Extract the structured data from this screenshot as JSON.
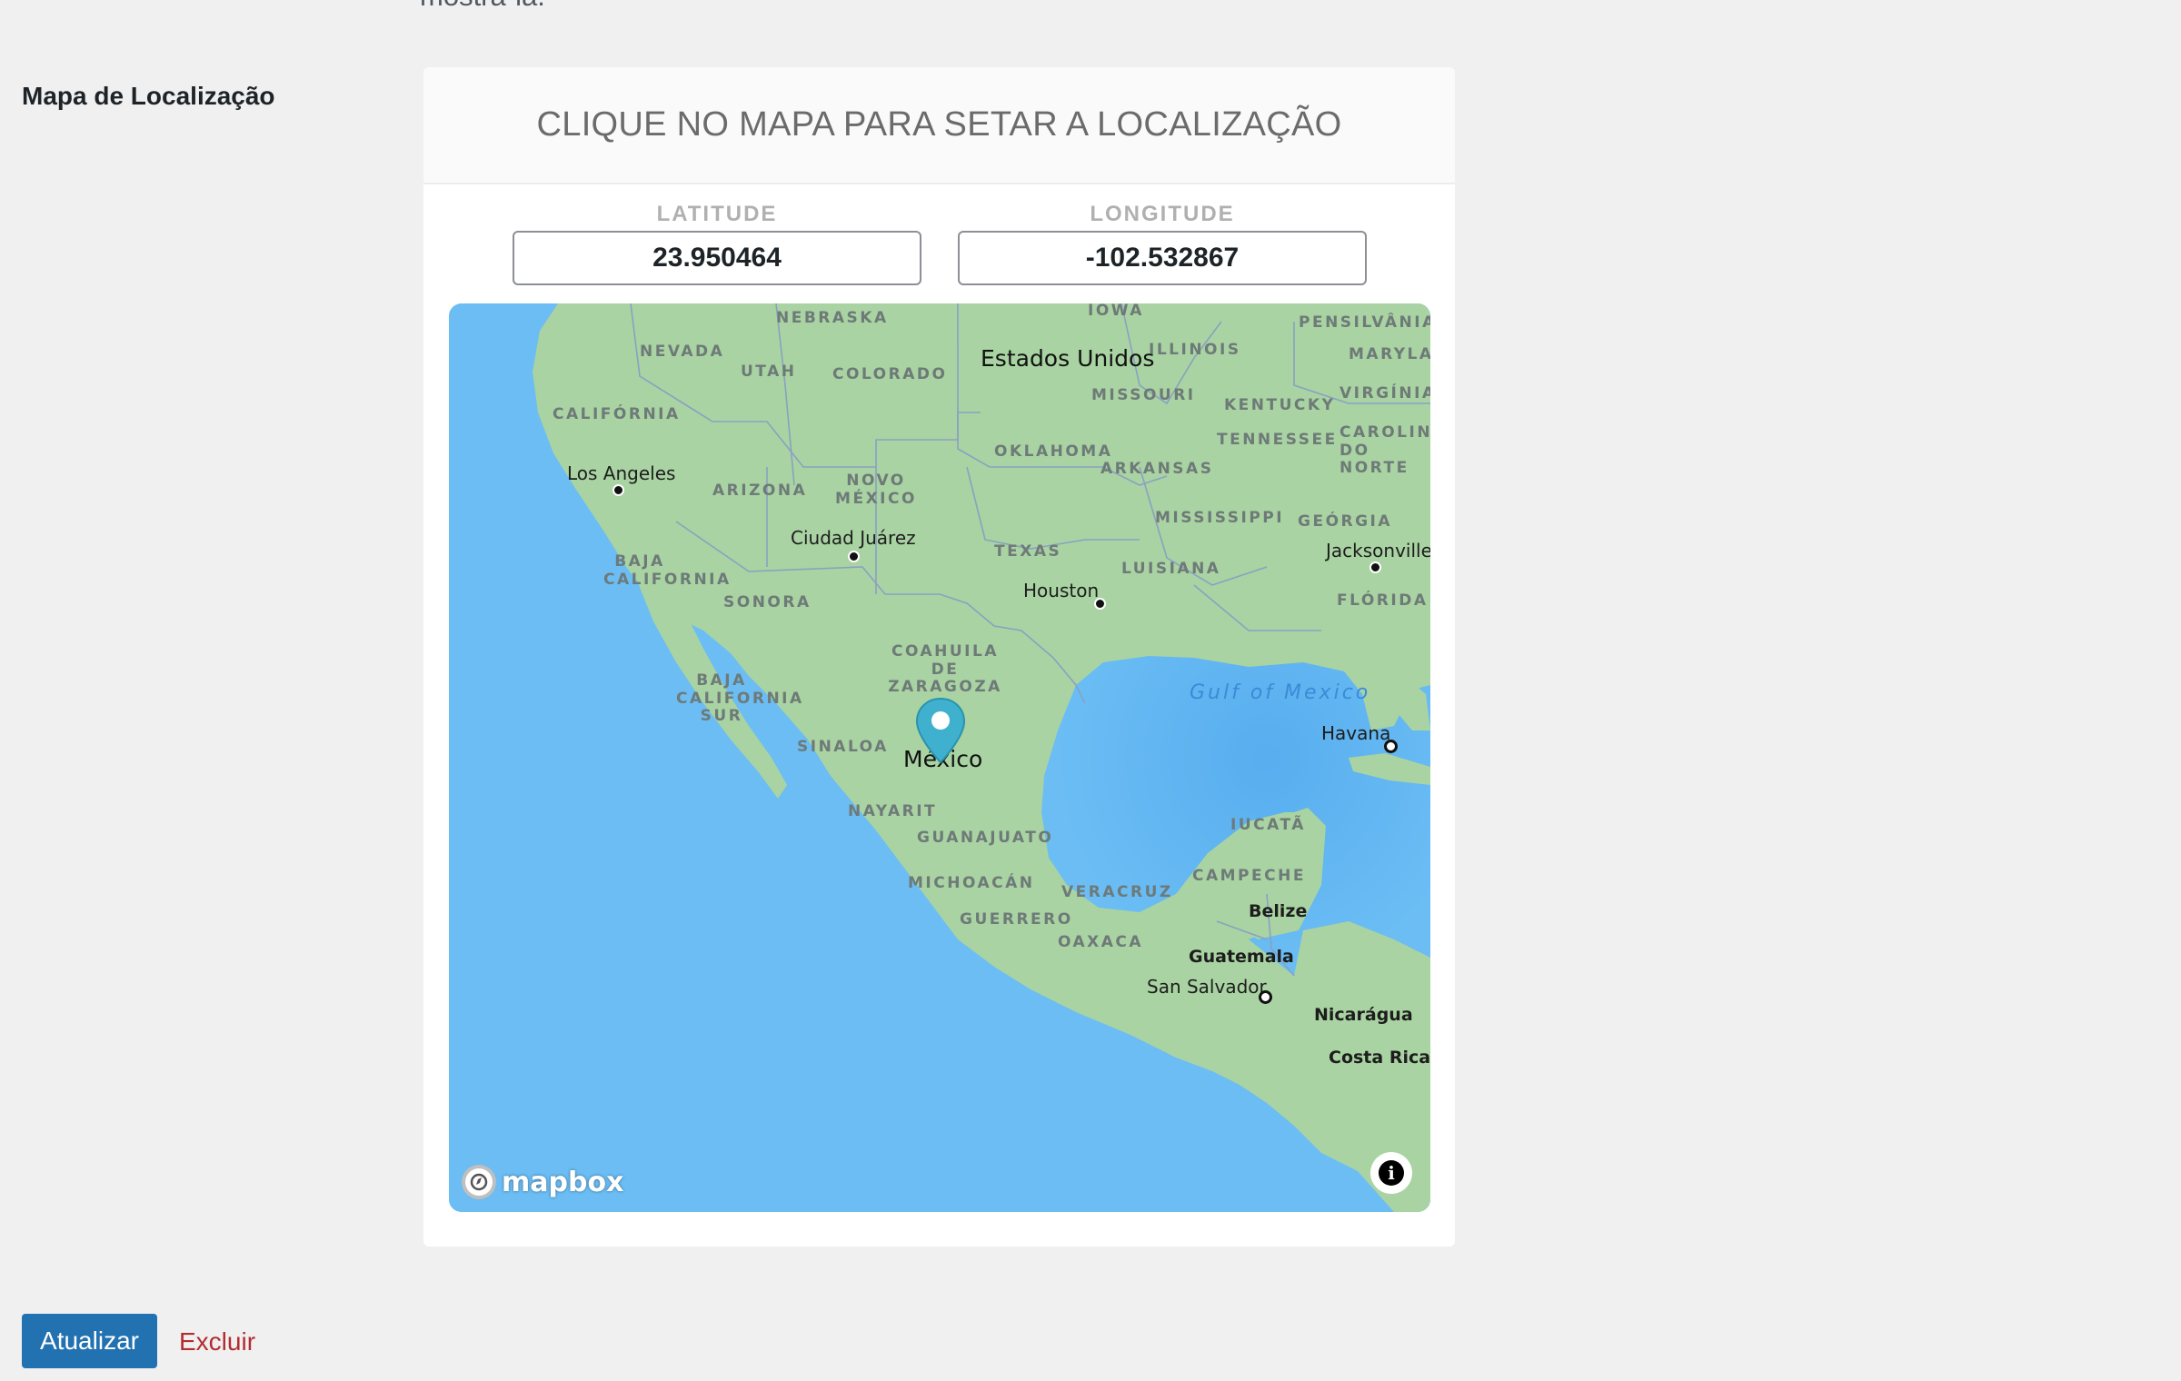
{
  "page": {
    "cutoff_text": "mostrá-la."
  },
  "field": {
    "label": "Mapa de Localização"
  },
  "panel": {
    "title": "CLIQUE NO MAPA PARA SETAR A LOCALIZAÇÃO"
  },
  "coordinates": {
    "latitude_label": "LATITUDE",
    "latitude_value": "23.950464",
    "longitude_label": "LONGITUDE",
    "longitude_value": "-102.532867"
  },
  "map": {
    "countries": [
      "Estados Unidos",
      "México",
      "Belize",
      "Guatemala",
      "Nicarágua",
      "Costa Rica"
    ],
    "states": [
      "NEBRASKA",
      "IOWA",
      "PENSILVÂNIA",
      "NEVADA",
      "UTAH",
      "COLORADO",
      "ILLINOIS",
      "MARYLAND",
      "CALIFÓRNIA",
      "MISSOURI",
      "KENTUCKY",
      "VIRGÍNIA",
      "OKLAHOMA",
      "TENNESSEE",
      "CAROLINA DO NORTE",
      "ARIZONA",
      "NOVO MÉXICO",
      "ARKANSAS",
      "MISSISSIPPI",
      "GEÓRGIA",
      "BAJA CALIFORNIA",
      "TEXAS",
      "LUISIANA",
      "SONORA",
      "FLÓRIDA",
      "COAHUILA DE ZARAGOZA",
      "BAJA CALIFORNIA SUR",
      "SINALOA",
      "NAYARIT",
      "IUCATÃ",
      "GUANAJUATO",
      "CAMPECHE",
      "MICHOACÁN",
      "VERACRUZ",
      "GUERRERO",
      "OAXACA"
    ],
    "cities": [
      "Los Angeles",
      "Ciudad Juárez",
      "Houston",
      "Jacksonville",
      "Havana",
      "San Salvador"
    ],
    "sea": "Gulf of Mexico",
    "attribution": "mapbox",
    "marker_icon": "map-pin-icon",
    "info_icon": "info-icon",
    "water_color": "#6bbdf4",
    "land_color": "#a9d3a2",
    "marker_color": "#3fb1ce"
  },
  "actions": {
    "update_label": "Atualizar",
    "delete_label": "Excluir"
  }
}
